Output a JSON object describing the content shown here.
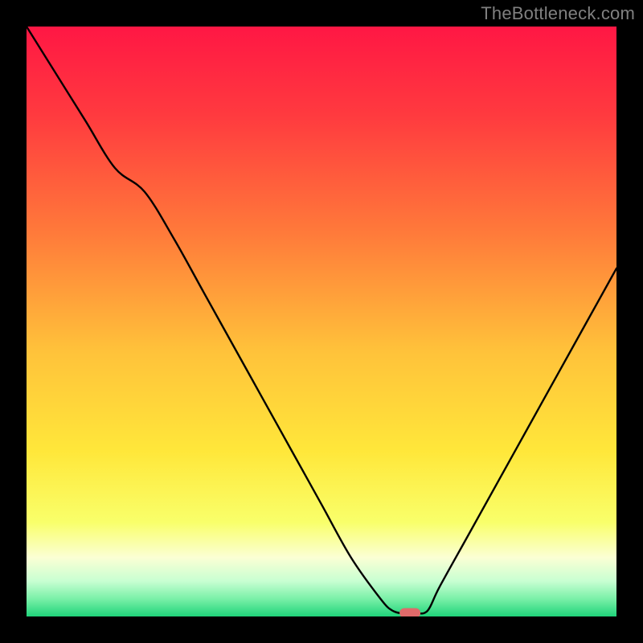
{
  "watermark": "TheBottleneck.com",
  "chart_data": {
    "type": "line",
    "title": "",
    "xlabel": "",
    "ylabel": "",
    "xlim": [
      0,
      100
    ],
    "ylim": [
      0,
      100
    ],
    "x": [
      0,
      5,
      10,
      15,
      20,
      25,
      30,
      35,
      40,
      45,
      50,
      55,
      60,
      62,
      64,
      66,
      68,
      70,
      75,
      80,
      85,
      90,
      95,
      100
    ],
    "values": [
      100,
      92,
      84,
      76,
      72,
      64,
      55,
      46,
      37,
      28,
      19,
      10,
      3,
      1,
      0.5,
      0.5,
      1,
      5,
      14,
      23,
      32,
      41,
      50,
      59
    ],
    "marker": {
      "x": 65,
      "y": 0.6
    },
    "gradient_stops": [
      {
        "offset": 0.0,
        "color": "#ff1744"
      },
      {
        "offset": 0.15,
        "color": "#ff3a3f"
      },
      {
        "offset": 0.35,
        "color": "#ff7a3a"
      },
      {
        "offset": 0.55,
        "color": "#ffc23a"
      },
      {
        "offset": 0.72,
        "color": "#ffe73a"
      },
      {
        "offset": 0.84,
        "color": "#f9ff6a"
      },
      {
        "offset": 0.9,
        "color": "#fbffd4"
      },
      {
        "offset": 0.94,
        "color": "#c8ffd2"
      },
      {
        "offset": 0.97,
        "color": "#7af0a8"
      },
      {
        "offset": 1.0,
        "color": "#1fd47a"
      }
    ],
    "curve_color": "#000000",
    "marker_color": "#e06a6a"
  }
}
